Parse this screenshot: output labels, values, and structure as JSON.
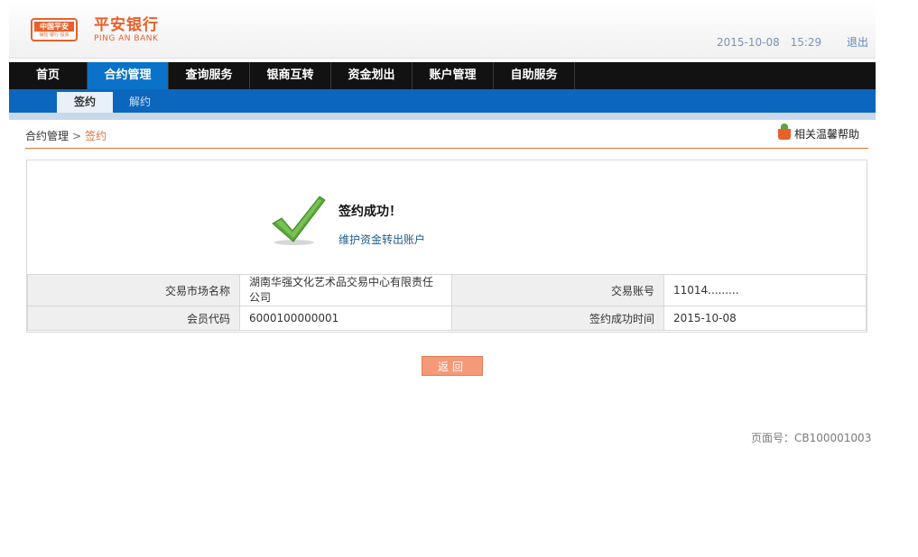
{
  "header": {
    "logo_badge": "中国平安",
    "logo_badge_sub": "保险·银行·投资",
    "logo_cn": "平安银行",
    "logo_en": "PING AN BANK",
    "date": "2015-10-08",
    "time": "15:29",
    "logout": "退出"
  },
  "nav": {
    "items": [
      {
        "label": "首页"
      },
      {
        "label": "合约管理"
      },
      {
        "label": "查询服务"
      },
      {
        "label": "银商互转"
      },
      {
        "label": "资金划出"
      },
      {
        "label": "账户管理"
      },
      {
        "label": "自助服务"
      }
    ],
    "active_index": 1
  },
  "subnav": {
    "tabs": [
      {
        "label": "签约"
      },
      {
        "label": "解约"
      }
    ]
  },
  "breadcrumb": {
    "parent": "合约管理",
    "separator": ">",
    "current": "签约"
  },
  "help": {
    "label": "相关温馨帮助"
  },
  "result": {
    "title": "签约成功！",
    "link": "维护资金转出账户"
  },
  "info": {
    "market_label": "交易市场名称",
    "market_value": "湖南华强文化艺术品交易中心有限责任公司",
    "account_label": "交易账号",
    "account_value": "11014.........",
    "member_label": "会员代码",
    "member_value": "6000100000001",
    "time_label": "签约成功时间",
    "time_value": "2015-10-08"
  },
  "actions": {
    "back": "返回"
  },
  "footer": {
    "page_no": "页面号：CB100001003"
  },
  "colors": {
    "brand_orange": "#e8602c",
    "nav_bg": "#121212",
    "nav_active": "#0a72c8",
    "subnav_bg": "#0b66bd",
    "check_green": "#5aa83a",
    "button_bg": "#f59a78"
  },
  "icons": {
    "success": "checkmark-icon",
    "help": "flowerpot-icon"
  }
}
